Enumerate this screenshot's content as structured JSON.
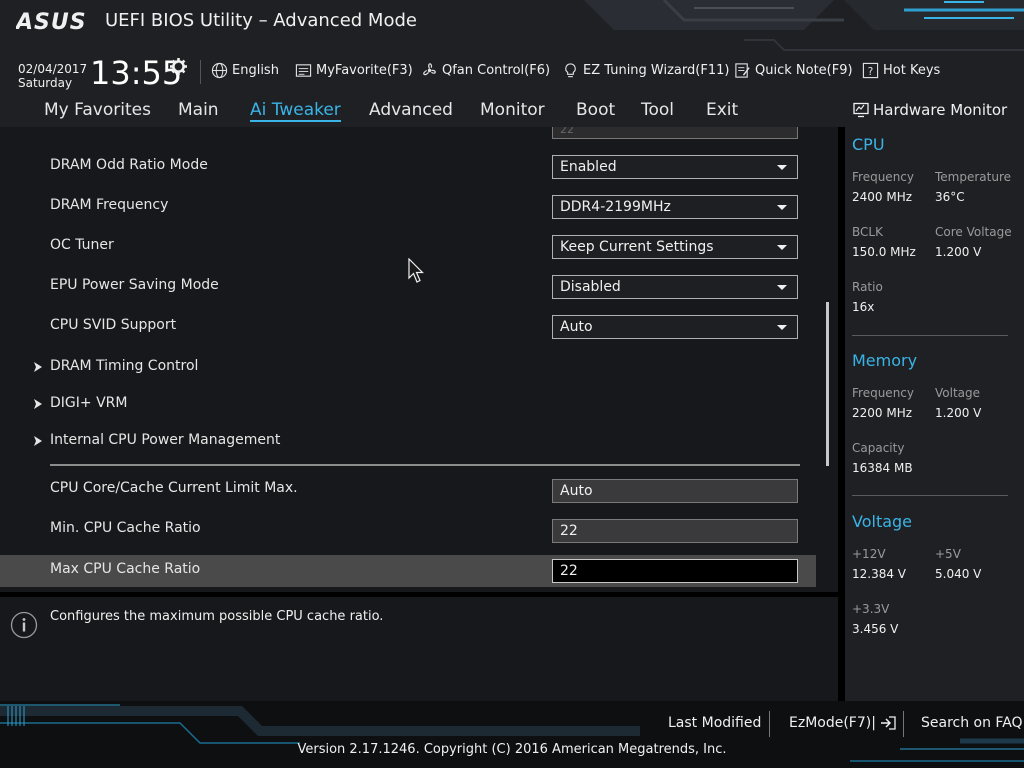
{
  "app": {
    "brand": "ASUS",
    "title": "UEFI BIOS Utility – Advanced Mode"
  },
  "clock": {
    "date": "02/04/2017",
    "day": "Saturday",
    "time": "13:55"
  },
  "toolbar": {
    "language": "English",
    "myfavorite": "MyFavorite(F3)",
    "qfan": "Qfan Control(F6)",
    "ez_tuning": "EZ Tuning Wizard(F11)",
    "quick_note": "Quick Note(F9)",
    "hot_keys": "Hot Keys"
  },
  "menu": {
    "items": [
      "My Favorites",
      "Main",
      "Ai Tweaker",
      "Advanced",
      "Monitor",
      "Boot",
      "Tool",
      "Exit"
    ],
    "active": "Ai Tweaker"
  },
  "settings": {
    "partial_top_value": "22",
    "rows": [
      {
        "label": "DRAM Odd Ratio Mode",
        "value": "Enabled"
      },
      {
        "label": "DRAM Frequency",
        "value": "DDR4-2199MHz"
      },
      {
        "label": "OC Tuner",
        "value": "Keep Current Settings"
      },
      {
        "label": "EPU Power Saving Mode",
        "value": "Disabled"
      },
      {
        "label": "CPU SVID Support",
        "value": "Auto"
      }
    ],
    "submenus": [
      "DRAM Timing Control",
      "DIGI+ VRM",
      "Internal CPU Power Management"
    ],
    "fields": [
      {
        "label": "CPU Core/Cache Current Limit Max.",
        "value": "Auto"
      },
      {
        "label": "Min. CPU Cache Ratio",
        "value": "22"
      },
      {
        "label": "Max CPU Cache Ratio",
        "value": "22"
      }
    ]
  },
  "help": {
    "text": "Configures the maximum possible CPU cache ratio."
  },
  "hardware_monitor": {
    "title": "Hardware Monitor",
    "cpu": {
      "heading": "CPU",
      "frequency_label": "Frequency",
      "frequency": "2400 MHz",
      "temperature_label": "Temperature",
      "temperature": "36°C",
      "bclk_label": "BCLK",
      "bclk": "150.0 MHz",
      "core_voltage_label": "Core Voltage",
      "core_voltage": "1.200 V",
      "ratio_label": "Ratio",
      "ratio": "16x"
    },
    "memory": {
      "heading": "Memory",
      "frequency_label": "Frequency",
      "frequency": "2200 MHz",
      "voltage_label": "Voltage",
      "voltage": "1.200 V",
      "capacity_label": "Capacity",
      "capacity": "16384 MB"
    },
    "voltage": {
      "heading": "Voltage",
      "v12_label": "+12V",
      "v12": "12.384 V",
      "v5_label": "+5V",
      "v5": "5.040 V",
      "v33_label": "+3.3V",
      "v33": "3.456 V"
    }
  },
  "footer": {
    "last_modified": "Last Modified",
    "ezmode": "EzMode(F7)|",
    "search_faq": "Search on FAQ",
    "copyright": "Version 2.17.1246. Copyright (C) 2016 American Megatrends, Inc."
  },
  "colors": {
    "accent": "#3ab4e6",
    "background": "#17181b",
    "panel": "#1e2024",
    "selected_row": "#4a4a4a"
  }
}
